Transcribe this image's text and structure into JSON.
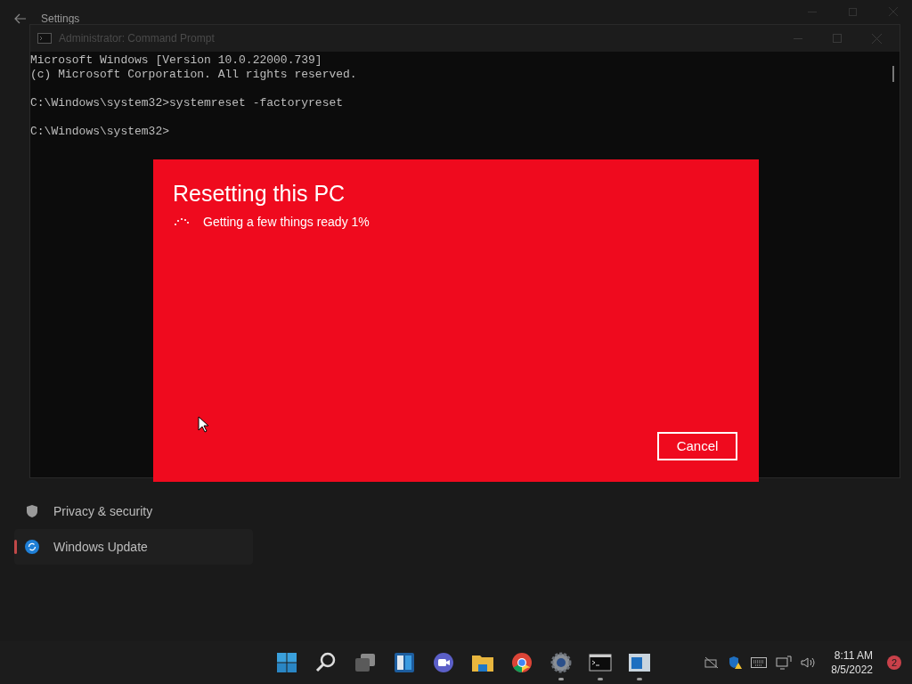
{
  "settings_window": {
    "title": "Settings",
    "sidebar": {
      "items": [
        {
          "label": "Privacy & security",
          "kind": "shield",
          "selected": false
        },
        {
          "label": "Windows Update",
          "kind": "update",
          "selected": true
        }
      ]
    }
  },
  "console_window": {
    "title": "Administrator: Command Prompt",
    "blocks": [
      [
        "Microsoft Windows [Version 10.0.22000.739]",
        "(c) Microsoft Corporation. All rights reserved."
      ],
      [
        "C:\\Windows\\system32>systemreset -factoryreset"
      ],
      [
        "C:\\Windows\\system32>"
      ]
    ]
  },
  "dialog": {
    "title": "Resetting this PC",
    "status": "Getting a few things ready 1%",
    "buttons": [
      "Cancel"
    ]
  },
  "taskbar": {
    "apps": [
      {
        "kind": "start",
        "running": false
      },
      {
        "kind": "search",
        "running": false
      },
      {
        "kind": "taskview",
        "running": false
      },
      {
        "kind": "widgets",
        "running": false
      },
      {
        "kind": "chat",
        "running": false
      },
      {
        "kind": "folder",
        "running": false
      },
      {
        "kind": "browser",
        "running": false
      },
      {
        "kind": "settings",
        "running": true
      },
      {
        "kind": "console",
        "running": true
      },
      {
        "kind": "app",
        "running": true
      }
    ],
    "time": "8:11 AM",
    "date": "8/5/2022",
    "notification_count": "2"
  }
}
